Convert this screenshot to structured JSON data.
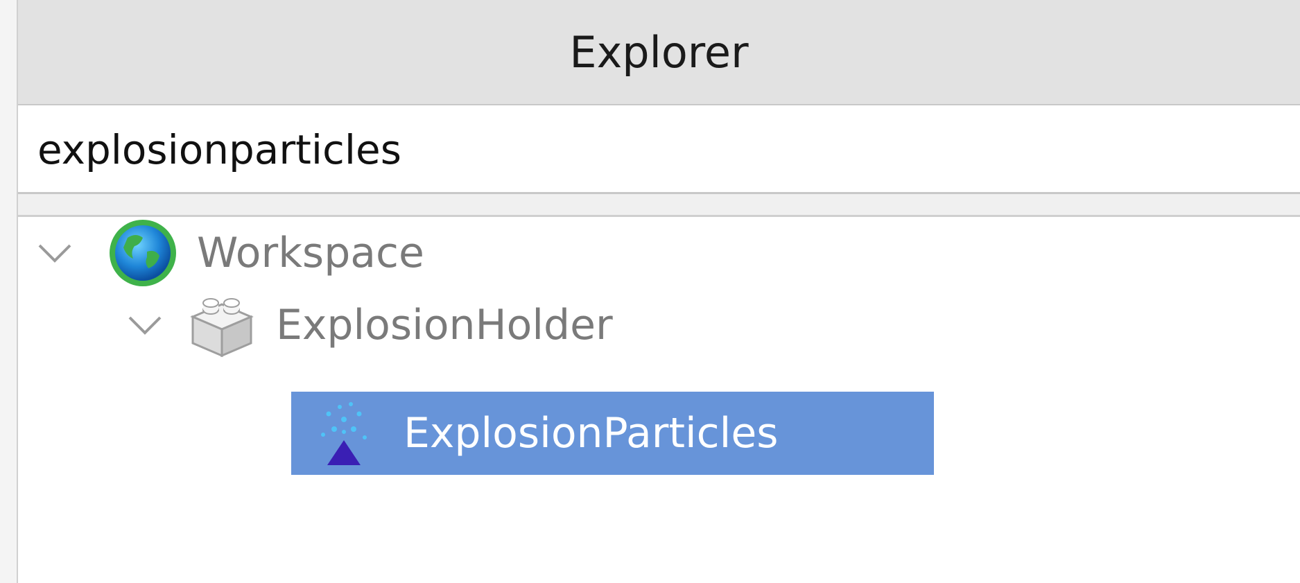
{
  "panel": {
    "title": "Explorer"
  },
  "search": {
    "value": "explosionparticles"
  },
  "tree": {
    "items": [
      {
        "label": "Workspace",
        "icon": "globe-icon",
        "expanded": true,
        "selected": false
      },
      {
        "label": "ExplosionHolder",
        "icon": "model-icon",
        "expanded": true,
        "selected": false
      },
      {
        "label": "ExplosionParticles",
        "icon": "particle-emitter-icon",
        "expanded": false,
        "selected": true
      }
    ]
  },
  "colors": {
    "header_bg": "#e2e2e2",
    "selection": "#6794d9",
    "label_text": "#7a7a7a",
    "selected_text": "#ffffff"
  }
}
